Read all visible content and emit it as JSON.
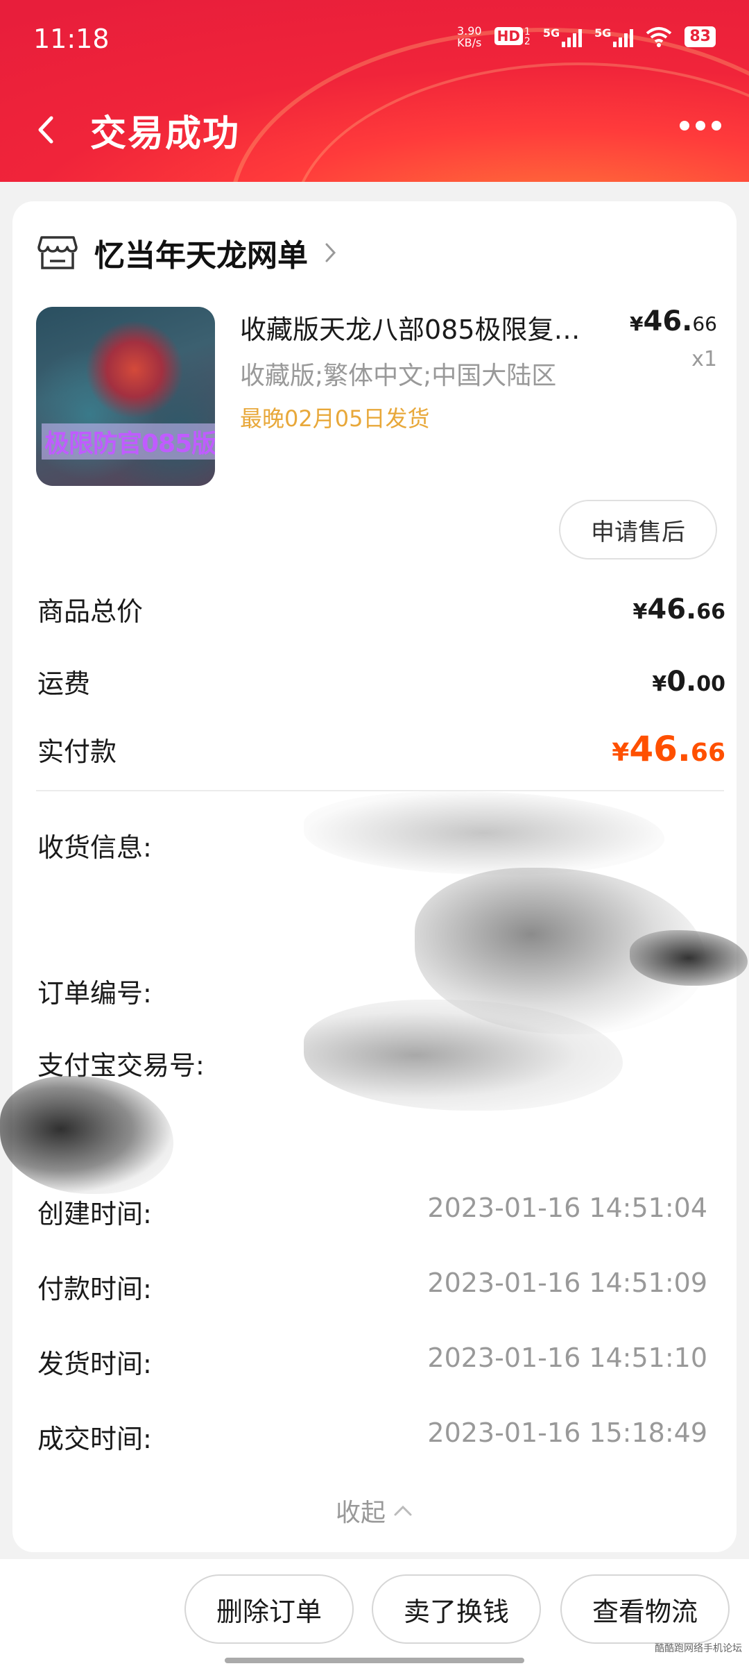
{
  "status_bar": {
    "time": "11:18",
    "net_speed_value": "3.90",
    "net_speed_unit": "KB/s",
    "hd_label": "HD",
    "sim1": "1",
    "sim2": "2",
    "sig1_label": "5G",
    "sig2_label": "5G",
    "battery": "83"
  },
  "nav": {
    "title": "交易成功"
  },
  "shop": {
    "name": "忆当年天龙网单"
  },
  "product": {
    "image_label": "极限防官085版",
    "title": "收藏版天龙八部085极限复…",
    "spec": "收藏版;繁体中文;中国大陆区",
    "ship_note": "最晚02月05日发货",
    "price_yen": "¥",
    "price_int": "46.",
    "price_dec": "66",
    "qty": "x1"
  },
  "after_sale_label": "申请售后",
  "summary": {
    "goods_total_label": "商品总价",
    "goods_total_yen": "¥",
    "goods_total_int": "46.",
    "goods_total_dec": "66",
    "shipping_label": "运费",
    "shipping_yen": "¥",
    "shipping_int": "0.",
    "shipping_dec": "00",
    "paid_label": "实付款",
    "paid_yen": "¥",
    "paid_int": "46.",
    "paid_dec": "66"
  },
  "info": {
    "receiver_label": "收货信息:",
    "order_no_label": "订单编号:",
    "alipay_no_label": "支付宝交易号:",
    "created_label": "创建时间:",
    "created_value": "2023-01-16 14:51:04",
    "paid_label": "付款时间:",
    "paid_value": "2023-01-16 14:51:09",
    "shipped_label": "发货时间:",
    "shipped_value": "2023-01-16 14:51:10",
    "closed_label": "成交时间:",
    "closed_value": "2023-01-16 15:18:49"
  },
  "collapse_label": "收起",
  "bottom_actions": {
    "delete": "删除订单",
    "sell": "卖了换钱",
    "logistics": "查看物流"
  },
  "watermark": "酷酷跑网络手机论坛"
}
